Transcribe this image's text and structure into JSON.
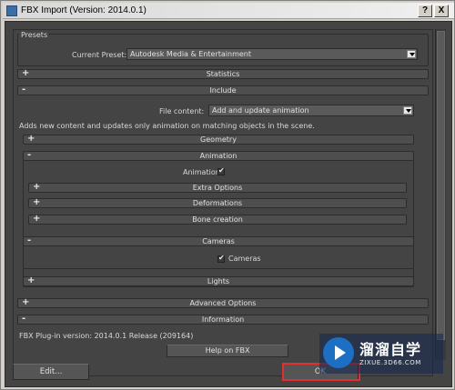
{
  "window": {
    "title": "FBX Import (Version: 2014.0.1)",
    "help_btn": "?",
    "close_btn": "X"
  },
  "presets": {
    "section_label": "Presets",
    "current_label": "Current Preset:",
    "current_value": "Autodesk Media & Entertainment"
  },
  "rollouts": {
    "statistics": {
      "sign": "+",
      "label": "Statistics"
    },
    "include": {
      "sign": "-",
      "label": "Include"
    },
    "geometry": {
      "sign": "+",
      "label": "Geometry"
    },
    "animation": {
      "sign": "-",
      "label": "Animation"
    },
    "extra_options": {
      "sign": "+",
      "label": "Extra Options"
    },
    "deformations": {
      "sign": "+",
      "label": "Deformations"
    },
    "bone_creation": {
      "sign": "+",
      "label": "Bone creation"
    },
    "cameras": {
      "sign": "-",
      "label": "Cameras"
    },
    "lights": {
      "sign": "+",
      "label": "Lights"
    },
    "advanced": {
      "sign": "+",
      "label": "Advanced Options"
    },
    "information": {
      "sign": "-",
      "label": "Information"
    }
  },
  "include": {
    "file_content_label": "File content:",
    "file_content_value": "Add and update animation",
    "description": "Adds new content and updates only animation on matching objects in the scene."
  },
  "animation": {
    "checkbox_label": "Animation",
    "checked": true
  },
  "cameras": {
    "checkbox_label": "Cameras",
    "checked": true
  },
  "information": {
    "plugin_version": "FBX Plug-in version: 2014.0.1 Release (209164)",
    "help_button": "Help on FBX"
  },
  "bottom": {
    "edit_button": "Edit...",
    "ok_button": "OK"
  },
  "watermark": {
    "name": "溜溜自学",
    "url": "ZIXUE.3D66.COM"
  },
  "colors": {
    "panel_bg": "#444444",
    "rollout_bg": "#4e4e4e",
    "highlight_red": "#e03030"
  }
}
